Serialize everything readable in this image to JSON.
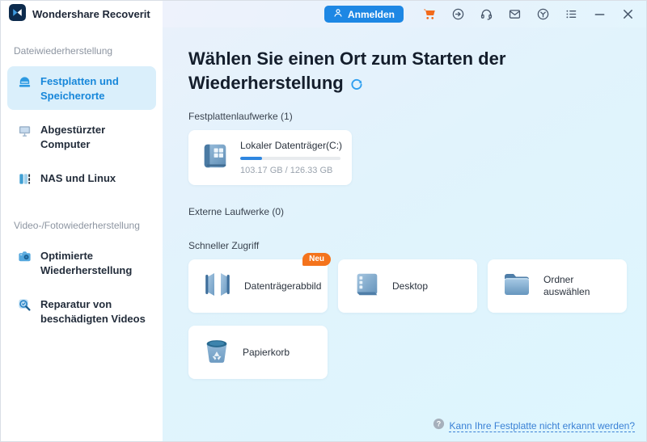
{
  "titlebar": {
    "app_title": "Wondershare Recoverit",
    "signin_label": "Anmelden",
    "icons": [
      "app-logo-icon",
      "user-icon",
      "cart-icon",
      "login-arrow-icon",
      "headset-icon",
      "mail-icon",
      "settings-icon",
      "menu-list-icon",
      "minimize-icon",
      "close-icon"
    ],
    "cart_color": "#f26a1b",
    "signin_color": "#1d87e4"
  },
  "sidebar": {
    "sections": [
      {
        "label": "Dateiwiederherstellung",
        "items": [
          {
            "label": "Festplatten und Speicherorte",
            "icon": "hard-drive-icon",
            "selected": true
          },
          {
            "label": "Abgestürzter Computer",
            "icon": "crashed-computer-icon",
            "selected": false
          },
          {
            "label": "NAS und Linux",
            "icon": "nas-server-icon",
            "selected": false
          }
        ]
      },
      {
        "label": "Video-/Fotowiederherstellung",
        "items": [
          {
            "label": "Optimierte Wiederherstellung",
            "icon": "camera-icon",
            "selected": false
          },
          {
            "label": "Reparatur von beschädigten Videos",
            "icon": "video-repair-icon",
            "selected": false
          }
        ]
      }
    ],
    "selected_bg": "#daeffb",
    "selected_text": "#1787da"
  },
  "main": {
    "title": "Wählen Sie einen Ort zum Starten der Wiederherstellung",
    "refresh_icon": "refresh-icon",
    "sections": {
      "hdd": "Festplattenlaufwerke (1)",
      "external": "Externe Laufwerke (0)",
      "quick": "Schneller Zugriff"
    },
    "drive": {
      "name": "Lokaler Datenträger(C:)",
      "capacity": "103.17 GB / 126.33 GB",
      "progress_percent": 22,
      "icon": "windows-disk-icon"
    },
    "quick_access": [
      {
        "label": "Datenträgerabbild",
        "icon": "disk-image-icon",
        "badge": "Neu"
      },
      {
        "label": "Desktop",
        "icon": "desktop-icon"
      },
      {
        "label": "Ordner auswählen",
        "icon": "folder-icon"
      },
      {
        "label": "Papierkorb",
        "icon": "recycle-bin-icon"
      }
    ],
    "badge_color": "#f4731c",
    "footer_link": "Kann Ihre Festplatte nicht erkannt werden?",
    "footer_icon": "question-icon"
  }
}
